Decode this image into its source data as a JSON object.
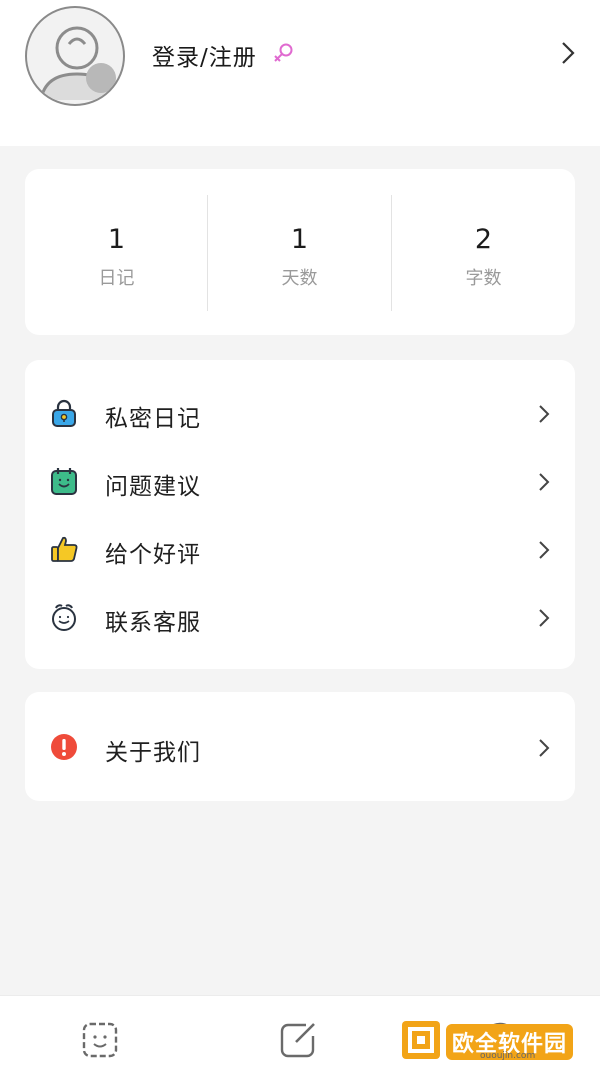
{
  "profile": {
    "name": "登录/注册",
    "gender_icon": "female-symbol-icon",
    "avatar_icon": "default-avatar-icon"
  },
  "stats": [
    {
      "value": "1",
      "label": "日记"
    },
    {
      "value": "1",
      "label": "天数"
    },
    {
      "value": "2",
      "label": "字数"
    }
  ],
  "menu": {
    "items": [
      {
        "label": "私密日记",
        "icon": "lock-icon"
      },
      {
        "label": "问题建议",
        "icon": "calendar-smile-icon"
      },
      {
        "label": "给个好评",
        "icon": "thumbs-up-icon"
      },
      {
        "label": "联系客服",
        "icon": "alarm-clock-icon"
      }
    ]
  },
  "about": {
    "label": "关于我们",
    "icon": "alert-circle-icon"
  },
  "tabbar": {
    "tabs": [
      {
        "icon": "diary-face-icon"
      },
      {
        "icon": "edit-icon"
      },
      {
        "icon": "profile-icon"
      }
    ]
  },
  "watermark": {
    "text": "欧全软件园",
    "sub": "ououjin.com"
  },
  "colors": {
    "background": "#f4f4f4",
    "card": "#ffffff",
    "accent_pink": "#e06ad0",
    "lock_blue": "#3aa7e8",
    "calendar_green": "#3dbb8a",
    "thumb_yellow": "#f5c825",
    "alert_red": "#ef4b3a"
  }
}
